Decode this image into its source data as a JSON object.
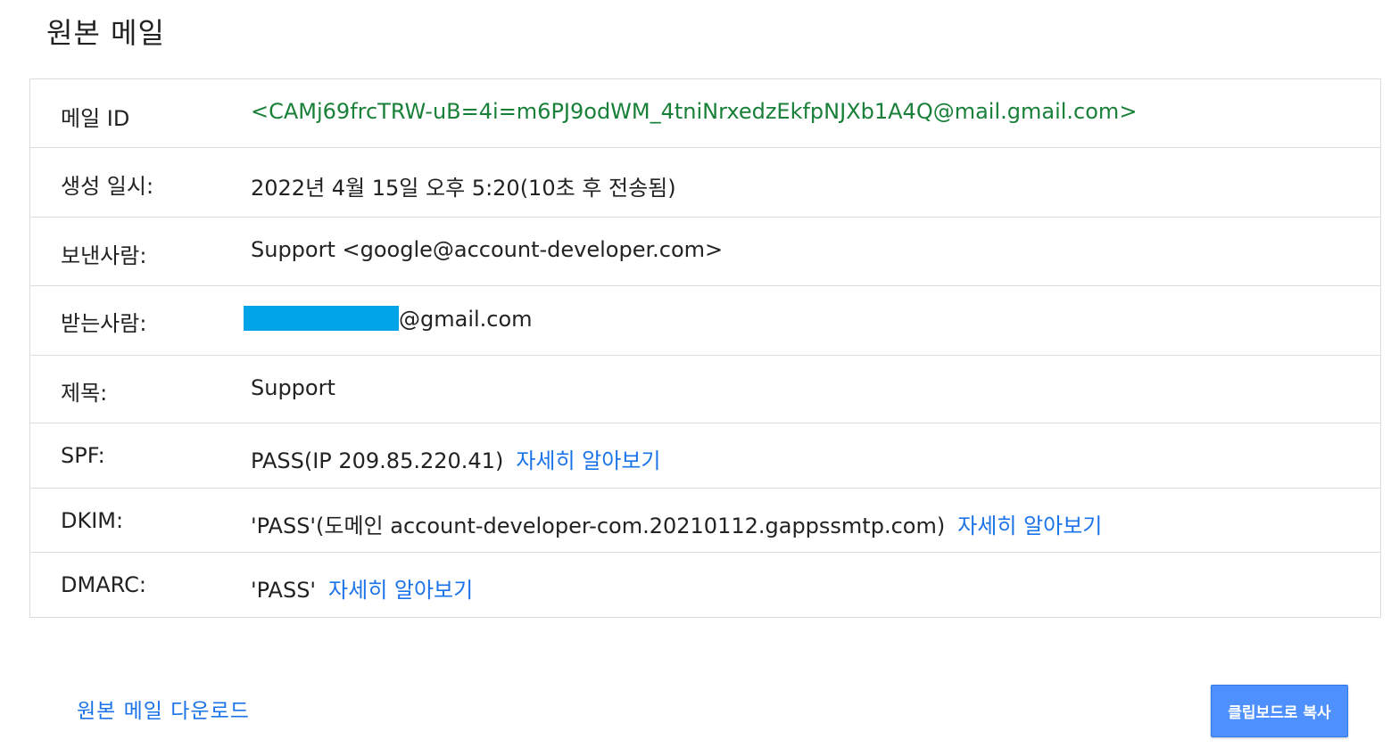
{
  "page": {
    "title": "원본 메일"
  },
  "details": {
    "message_id": {
      "label": "메일 ID",
      "value": "<CAMj69frcTRW-uB=4i=m6PJ9odWM_4tniNrxedzEkfpNJXb1A4Q@mail.gmail.com>"
    },
    "created": {
      "label": "생성 일시:",
      "value": "2022년 4월 15일 오후 5:20(10초 후 전송됨)"
    },
    "from": {
      "label": "보낸사람:",
      "value": "Support <google@account-developer.com>"
    },
    "to": {
      "label": "받는사람:",
      "value_suffix": "@gmail.com"
    },
    "subject": {
      "label": "제목:",
      "value": "Support"
    },
    "spf": {
      "label": "SPF:",
      "value": "PASS(IP 209.85.220.41)",
      "link": "자세히 알아보기"
    },
    "dkim": {
      "label": "DKIM:",
      "value": "'PASS'(도메인 account-developer-com.20210112.gappssmtp.com)",
      "link": "자세히 알아보기"
    },
    "dmarc": {
      "label": "DMARC:",
      "value": "'PASS'",
      "link": "자세히 알아보기"
    }
  },
  "footer": {
    "download_link": "원본 메일 다운로드",
    "copy_button": "클립보드로 복사"
  },
  "colors": {
    "link": "#1a73e8",
    "message_id": "#188038",
    "redaction": "#00a2e8",
    "button": "#4d90fe"
  }
}
